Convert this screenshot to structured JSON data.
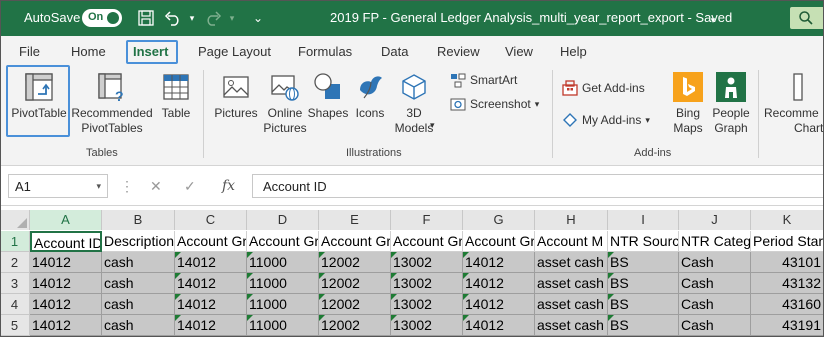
{
  "titlebar": {
    "autosave_label": "AutoSave",
    "autosave_state": "On",
    "document_title": "2019 FP - General Ledger Analysis_multi_year_report_export  -  Saved",
    "colors": {
      "brand": "#217346"
    }
  },
  "tabs": [
    "File",
    "Home",
    "Insert",
    "Page Layout",
    "Formulas",
    "Data",
    "Review",
    "View",
    "Help"
  ],
  "active_tab": "Insert",
  "ribbon": {
    "tables": {
      "pivottable": "PivotTable",
      "recommended_1": "Recommended",
      "recommended_2": "PivotTables",
      "table": "Table",
      "group": "Tables"
    },
    "illustrations": {
      "pictures": "Pictures",
      "online_1": "Online",
      "online_2": "Pictures",
      "shapes": "Shapes",
      "icons": "Icons",
      "models_1": "3D",
      "models_2": "Models",
      "smartart": "SmartArt",
      "screenshot": "Screenshot",
      "group": "Illustrations"
    },
    "addins": {
      "get": "Get Add-ins",
      "my": "My Add-ins",
      "bing_1": "Bing",
      "bing_2": "Maps",
      "people_1": "People",
      "people_2": "Graph",
      "group": "Add-ins"
    },
    "charts": {
      "recommended_1": "Recomme",
      "recommended_2": "Chart"
    }
  },
  "formula_bar": {
    "name_box": "A1",
    "fx": "fx",
    "formula": "Account ID"
  },
  "grid": {
    "columns": [
      "A",
      "B",
      "C",
      "D",
      "E",
      "F",
      "G",
      "H",
      "I",
      "J",
      "K"
    ],
    "row_numbers": [
      "1",
      "2",
      "3",
      "4",
      "5"
    ],
    "header_row": [
      "Account ID",
      "Description",
      "Account Gr",
      "Account Gr",
      "Account Gr",
      "Account Gr",
      "Account Gr",
      "Account M",
      "NTR Source",
      "NTR Categ",
      "Period Star"
    ],
    "rows": [
      [
        "14012",
        "cash",
        "14012",
        "11000",
        "12002",
        "13002",
        "14012",
        "asset cash",
        "BS",
        "Cash",
        "43101"
      ],
      [
        "14012",
        "cash",
        "14012",
        "11000",
        "12002",
        "13002",
        "14012",
        "asset cash",
        "BS",
        "Cash",
        "43132"
      ],
      [
        "14012",
        "cash",
        "14012",
        "11000",
        "12002",
        "13002",
        "14012",
        "asset cash",
        "BS",
        "Cash",
        "43160"
      ],
      [
        "14012",
        "cash",
        "14012",
        "11000",
        "12002",
        "13002",
        "14012",
        "asset cash",
        "BS",
        "Cash",
        "43191"
      ]
    ]
  }
}
